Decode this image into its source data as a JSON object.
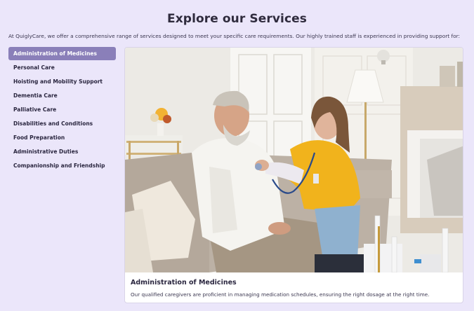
{
  "header": {
    "title": "Explore our Services",
    "intro": "At QuiglyCare, we offer a comprehensive range of services designed to meet your specific care requirements. Our highly trained staff is experienced in providing support for:"
  },
  "services": {
    "items": [
      {
        "label": "Administration of Medicines",
        "active": true
      },
      {
        "label": "Personal Care",
        "active": false
      },
      {
        "label": "Hoisting and Mobility Support",
        "active": false
      },
      {
        "label": "Dementia Care",
        "active": false
      },
      {
        "label": "Palliative Care",
        "active": false
      },
      {
        "label": "Disabilities and Conditions",
        "active": false
      },
      {
        "label": "Food Preparation",
        "active": false
      },
      {
        "label": "Administrative Duties",
        "active": false
      },
      {
        "label": "Companionship and Friendship",
        "active": false
      }
    ]
  },
  "detail": {
    "title": "Administration of Medicines",
    "description": "Our qualified caregivers are proficient in managing medication schedules, ensuring the right dosage at the right time.",
    "image_subject": "caregiver-listening-to-elderly-man-with-stethoscope"
  },
  "colors": {
    "background": "#ebe6fa",
    "active_item": "#8a7fb9",
    "caregiver_shirt": "#f0b21a",
    "sofa": "#b9aea3"
  }
}
